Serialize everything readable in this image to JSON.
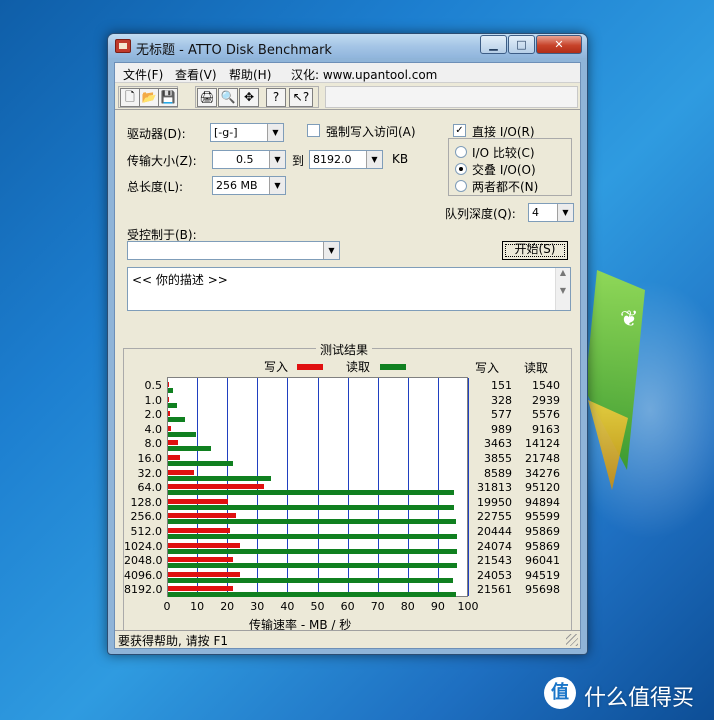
{
  "window": {
    "title": "无标题 - ATTO Disk Benchmark"
  },
  "menu": [
    {
      "label": "文件(F)"
    },
    {
      "label": "查看(V)"
    },
    {
      "label": "帮助(H)"
    },
    {
      "label": "汉化: www.upantool.com"
    }
  ],
  "toolbar": {
    "icons": [
      "new-file-icon",
      "open-folder-icon",
      "save-icon",
      "print-icon",
      "print-preview-icon",
      "move-icon",
      "help-icon",
      "context-help-icon"
    ],
    "glyphs": [
      "🗋",
      "📂",
      "💾",
      "🖨",
      "🔍",
      "✥",
      "?",
      "↖?"
    ]
  },
  "form": {
    "drive_label": "驱动器(D):",
    "drive_value": "[-g-]",
    "transfer_label": "传输大小(Z):",
    "transfer_from": "0.5",
    "transfer_to_label": "到",
    "transfer_to": "8192.0",
    "transfer_unit": "KB",
    "length_label": "总长度(L):",
    "length_value": "256 MB",
    "force_write_label": "强制写入访问(A)",
    "force_write_checked": false,
    "direct_io_label": "直接 I/O(R)",
    "direct_io_checked": true,
    "radio_compare": "I/O 比较(C)",
    "radio_overlap": "交叠 I/O(O)",
    "radio_neither": "两者都不(N)",
    "radio_selected": "overlap",
    "queue_label": "队列深度(Q):",
    "queue_value": "4",
    "controlled_by_label": "受控制于(B):",
    "controlled_by_value": "",
    "start_button": "开始(S)",
    "description": "<< 你的描述 >>"
  },
  "results": {
    "title": "测试结果",
    "legend_write": "写入",
    "legend_read": "读取",
    "col_write": "写入",
    "col_read": "读取",
    "xaxis_title": "传输速率 - MB / 秒",
    "colors": {
      "write": "#e01010",
      "read": "#108020",
      "grid": "#2040c0"
    }
  },
  "chart_data": {
    "type": "bar",
    "orientation": "horizontal",
    "title": "测试结果",
    "xlabel": "传输速率 - MB / 秒",
    "xlim": [
      0,
      100
    ],
    "xticks": [
      "0",
      "10",
      "20",
      "30",
      "40",
      "50",
      "60",
      "70",
      "80",
      "90",
      "100"
    ],
    "categories": [
      "0.5",
      "1.0",
      "2.0",
      "4.0",
      "8.0",
      "16.0",
      "32.0",
      "64.0",
      "128.0",
      "256.0",
      "512.0",
      "1024.0",
      "2048.0",
      "4096.0",
      "8192.0"
    ],
    "series": [
      {
        "name": "写入",
        "values": [
          151,
          328,
          577,
          989,
          3463,
          3855,
          8589,
          31813,
          19950,
          22755,
          20444,
          24074,
          21543,
          24053,
          21561
        ]
      },
      {
        "name": "读取",
        "values": [
          1540,
          2939,
          5576,
          9163,
          14124,
          21748,
          34276,
          95120,
          94894,
          95599,
          95869,
          95869,
          96041,
          94519,
          95698
        ]
      }
    ],
    "values_unit_note": "bars plotted as value/1000 on 0-100 MB/s axis"
  },
  "statusbar": {
    "text": "要获得帮助, 请按 F1"
  },
  "watermark": {
    "badge": "值",
    "text": "什么值得买"
  }
}
